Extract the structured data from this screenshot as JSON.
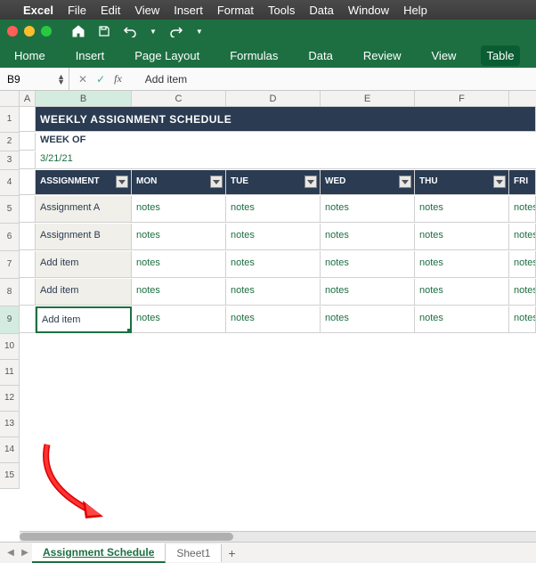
{
  "mac_menu": {
    "app": "Excel",
    "items": [
      "File",
      "Edit",
      "View",
      "Insert",
      "Format",
      "Tools",
      "Data",
      "Window",
      "Help"
    ]
  },
  "ribbon": {
    "tabs": [
      "Home",
      "Insert",
      "Page Layout",
      "Formulas",
      "Data",
      "Review",
      "View",
      "Table"
    ],
    "active": "Table"
  },
  "name_box": "B9",
  "formula_bar": "Add item",
  "title": "WEEKLY ASSIGNMENT SCHEDULE",
  "week_of_label": "WEEK OF",
  "week_of_date": "3/21/21",
  "headers": {
    "b": "ASSIGNMENT",
    "c": "MON",
    "d": "TUE",
    "e": "WED",
    "f": "THU",
    "g": "FRI"
  },
  "rows": [
    {
      "b": "Assignment A",
      "c": "notes",
      "d": "notes",
      "e": "notes",
      "f": "notes",
      "g": "notes"
    },
    {
      "b": "Assignment B",
      "c": "notes",
      "d": "notes",
      "e": "notes",
      "f": "notes",
      "g": "notes"
    },
    {
      "b": "Add item",
      "c": "notes",
      "d": "notes",
      "e": "notes",
      "f": "notes",
      "g": "notes"
    },
    {
      "b": "Add item",
      "c": "notes",
      "d": "notes",
      "e": "notes",
      "f": "notes",
      "g": "notes"
    },
    {
      "b": "Add item",
      "c": "notes",
      "d": "notes",
      "e": "notes",
      "f": "notes",
      "g": "notes"
    }
  ],
  "columns": [
    "A",
    "B",
    "C",
    "D",
    "E",
    "F"
  ],
  "row_nums_empty": [
    "10",
    "11",
    "12",
    "13",
    "14",
    "15"
  ],
  "sheets": {
    "active": "Assignment Schedule",
    "inactive": "Sheet1"
  }
}
